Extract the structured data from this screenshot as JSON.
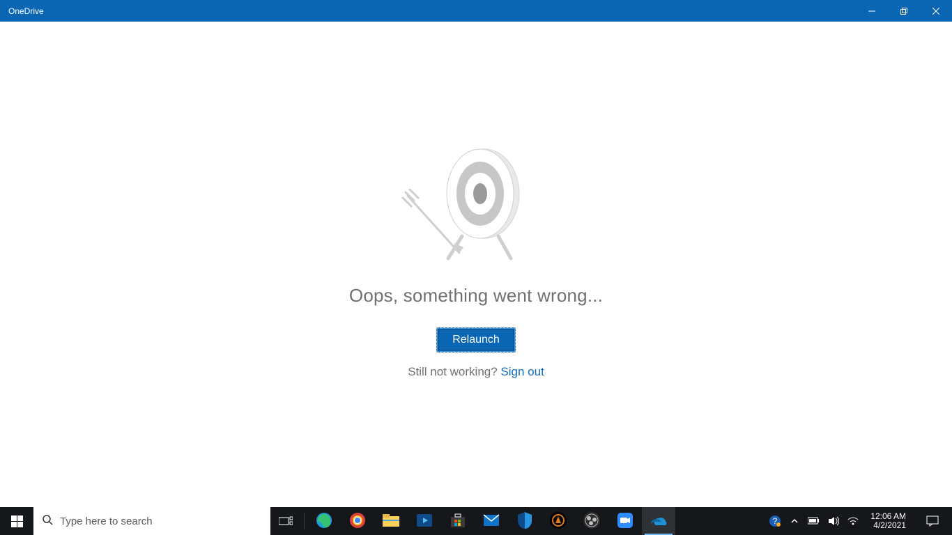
{
  "window": {
    "title": "OneDrive"
  },
  "main": {
    "message": "Oops, something went wrong...",
    "relaunch_label": "Relaunch",
    "still_text": "Still not working? ",
    "signout_label": "Sign out"
  },
  "taskbar": {
    "search_placeholder": "Type here to search",
    "apps": [
      {
        "name": "edge",
        "color": "#2db0d6",
        "active": false
      },
      {
        "name": "chrome",
        "color": "#f1c232",
        "active": false
      },
      {
        "name": "file-explorer",
        "color": "#f7c55b",
        "active": false
      },
      {
        "name": "movies-tv",
        "color": "#0f4a8a",
        "active": false
      },
      {
        "name": "microsoft-store",
        "color": "#303030",
        "active": false
      },
      {
        "name": "mail",
        "color": "#0f4a8a",
        "active": false
      },
      {
        "name": "security",
        "color": "#0f4a8a",
        "active": false
      },
      {
        "name": "hunger-games",
        "color": "#000000",
        "active": false
      },
      {
        "name": "obs",
        "color": "#2b2b2b",
        "active": false
      },
      {
        "name": "zoom",
        "color": "#2d8cff",
        "active": false
      },
      {
        "name": "onedrive",
        "color": "#0a66b2",
        "active": true
      }
    ],
    "tray": {
      "time": "12:06 AM",
      "date": "4/2/2021"
    }
  },
  "colors": {
    "accent": "#0a66b2",
    "link": "#0f6cbd",
    "muted": "#707070"
  }
}
